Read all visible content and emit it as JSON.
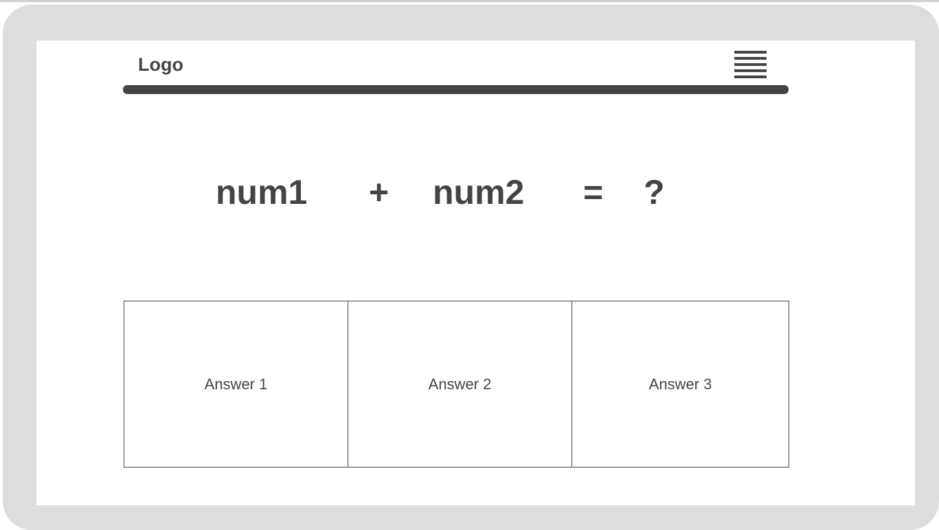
{
  "header": {
    "logo": "Logo",
    "menu_icon": "hamburger-menu-icon"
  },
  "equation": {
    "operand1": "num1",
    "operator": "+",
    "operand2": "num2",
    "equals": "=",
    "result": "?"
  },
  "answers": [
    {
      "label": "Answer 1"
    },
    {
      "label": "Answer 2"
    },
    {
      "label": "Answer 3"
    }
  ],
  "colors": {
    "frame": "#dddddd",
    "ink": "#444444",
    "screen": "#ffffff"
  }
}
